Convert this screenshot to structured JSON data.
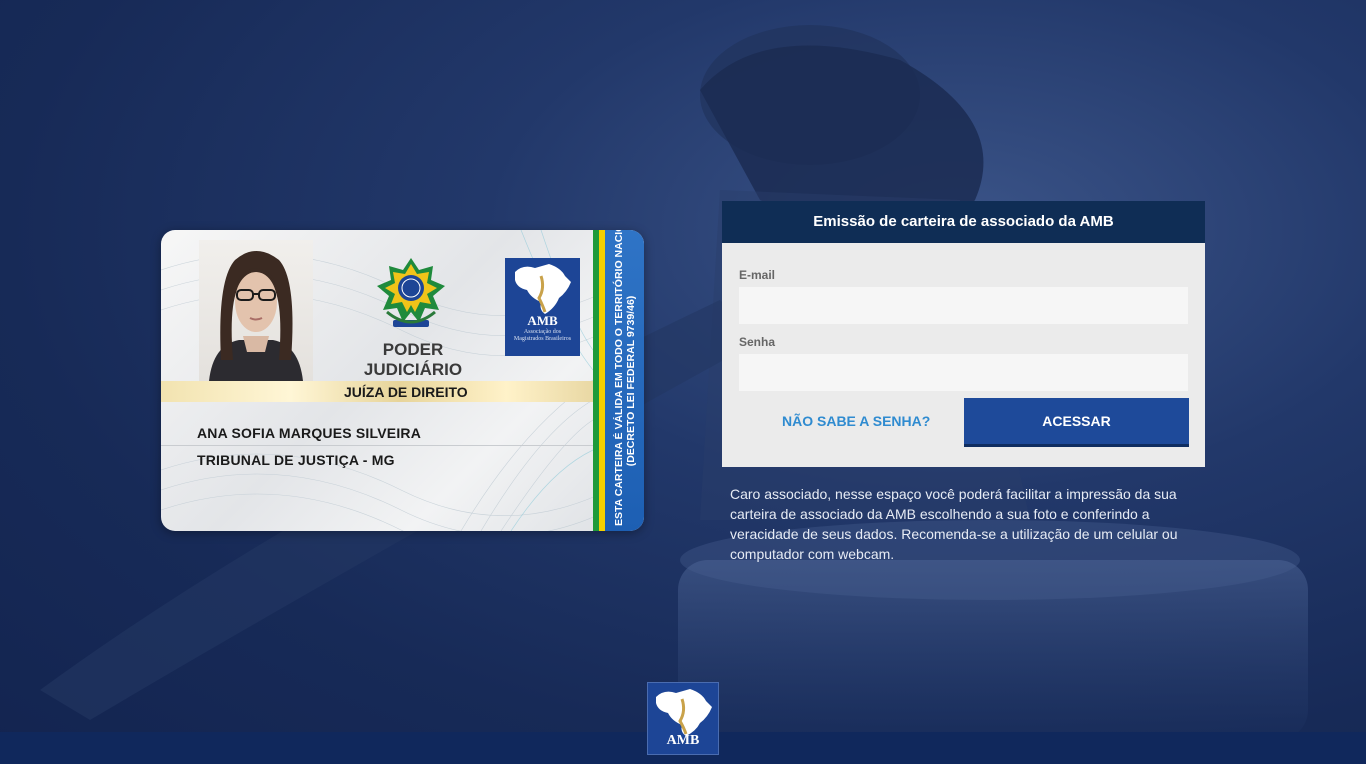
{
  "card": {
    "org_title": "PODER JUDICIÁRIO",
    "role": "JUÍZA DE DIREITO",
    "name": "ANA SOFIA MARQUES SILVEIRA",
    "court": "TRIBUNAL DE JUSTIÇA - MG",
    "validity_line1": "ESTA CARTEIRA É VÁLIDA EM TODO O TERRITÓRIO NACIONAL",
    "validity_line2": "(DECRETO LEI FEDERAL 9739/46)",
    "amb_logo_text": "AMB",
    "amb_logo_subtext": "Associação dos Magistrados Brasileiros"
  },
  "login": {
    "header_title": "Emissão de carteira de associado da AMB",
    "email_label": "E-mail",
    "email_value": "",
    "password_label": "Senha",
    "password_value": "",
    "forgot_label": "NÃO SABE A SENHA?",
    "submit_label": "ACESSAR"
  },
  "info_text": "Caro associado, nesse espaço você poderá facilitar a impressão da sua carteira de associado da AMB escolhendo a sua foto e conferindo a veracidade de seus dados. Recomenda-se a utilização de um celular ou computador com webcam.",
  "footer": {
    "logo_text": "AMB"
  },
  "colors": {
    "background": "#172a57",
    "panel_header": "#0f2d55",
    "button": "#1e4a9a",
    "link": "#2f8bd0",
    "amb_blue": "#1d4596"
  }
}
